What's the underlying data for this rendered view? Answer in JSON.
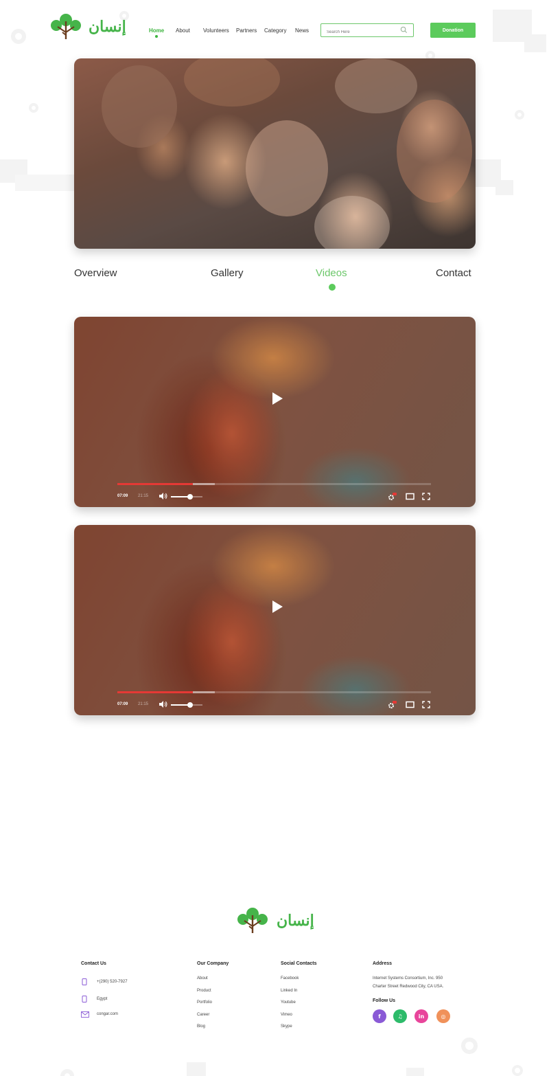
{
  "brand": {
    "logo_text": "إنسان",
    "colors": {
      "green": "#5ccb5c",
      "leaf": "#46b44a",
      "trunk": "#6b3d1e"
    }
  },
  "nav": {
    "items": [
      {
        "label": "Home",
        "active": true
      },
      {
        "label": "About"
      },
      {
        "label": "Volunteers"
      },
      {
        "label": "Partners"
      },
      {
        "label": "Category"
      },
      {
        "label": "News"
      }
    ],
    "search_placeholder": "Search Here",
    "donate_label": "Donation"
  },
  "tabs": [
    {
      "label": "Overview"
    },
    {
      "label": "Gallery"
    },
    {
      "label": "Videos",
      "active": true
    },
    {
      "label": "Contact"
    }
  ],
  "videos": [
    {
      "current_time": "07:09",
      "duration": "21:15",
      "played": 0.24,
      "buffered": 0.31,
      "volume": 0.6,
      "hd_badge": "HD"
    },
    {
      "current_time": "07:09",
      "duration": "21:15",
      "played": 0.24,
      "buffered": 0.31,
      "volume": 0.6,
      "hd_badge": "HD"
    }
  ],
  "footer": {
    "logo_text": "إنسان",
    "contact": {
      "title": "Contact Us",
      "phone": "+(290) 520-7927",
      "location": "Egypt",
      "email": "congar.com"
    },
    "company": {
      "title": "Our Company",
      "links": [
        "About",
        "Product",
        "Portfolio",
        "Career",
        "Blog"
      ]
    },
    "social_contacts": {
      "title": "Social Contacts",
      "links": [
        "Facebook",
        "Linked In",
        "Youtube",
        "Vimeo",
        "Skype"
      ]
    },
    "address": {
      "title": "Address",
      "line1": "Internet Systems Consortium, Inc. 950",
      "line2": "Charter Street Redwood City, CA USA."
    },
    "follow": {
      "title": "Follow Us",
      "icons": [
        {
          "name": "facebook-icon",
          "glyph": "f",
          "color": "#8a5ad6"
        },
        {
          "name": "spotify-icon",
          "glyph": "♫",
          "color": "#2dbb6a"
        },
        {
          "name": "linkedin-icon",
          "glyph": "in",
          "color": "#e8459b"
        },
        {
          "name": "instagram-icon",
          "glyph": "◎",
          "color": "#f0915a"
        }
      ]
    }
  }
}
